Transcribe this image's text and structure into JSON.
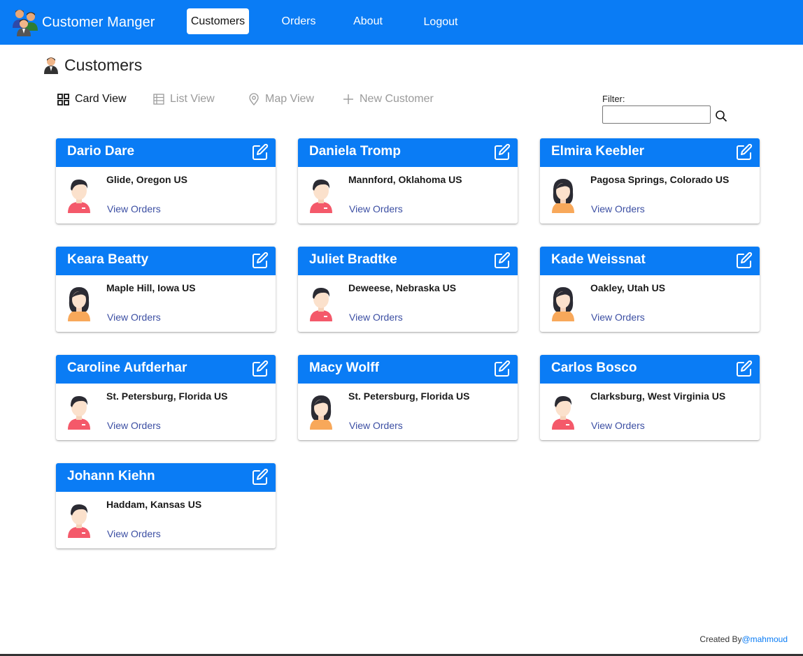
{
  "navbar": {
    "brand": "Customer Manger",
    "links": [
      {
        "label": "Customers",
        "active": true
      },
      {
        "label": "Orders",
        "active": false
      },
      {
        "label": "About",
        "active": false
      },
      {
        "label": "Logout",
        "active": false
      }
    ],
    "color": "#0a7cf5"
  },
  "page": {
    "title": "Customers"
  },
  "toolbar": {
    "card_view": "Card View",
    "list_view": "List View",
    "map_view": "Map View",
    "new_customer": "New Customer",
    "filter_label": "Filter:",
    "filter_value": ""
  },
  "customers": [
    {
      "name": "Dario Dare",
      "location": "Glide, Oregon US",
      "gender": "male",
      "link": "View Orders"
    },
    {
      "name": "Daniela Tromp",
      "location": "Mannford, Oklahoma US",
      "gender": "male",
      "link": "View Orders"
    },
    {
      "name": "Elmira Keebler",
      "location": "Pagosa Springs, Colorado US",
      "gender": "female",
      "link": "View Orders"
    },
    {
      "name": "Keara Beatty",
      "location": "Maple Hill, Iowa US",
      "gender": "female",
      "link": "View Orders"
    },
    {
      "name": "Juliet Bradtke",
      "location": "Deweese, Nebraska US",
      "gender": "male",
      "link": "View Orders"
    },
    {
      "name": "Kade Weissnat",
      "location": "Oakley, Utah US",
      "gender": "female",
      "link": "View Orders"
    },
    {
      "name": "Caroline Aufderhar",
      "location": "St. Petersburg, Florida US",
      "gender": "male",
      "link": "View Orders"
    },
    {
      "name": "Macy Wolff",
      "location": "St. Petersburg, Florida US",
      "gender": "female",
      "link": "View Orders"
    },
    {
      "name": "Carlos Bosco",
      "location": "Clarksburg, West Virginia US",
      "gender": "male",
      "link": "View Orders"
    },
    {
      "name": "Johann Kiehn",
      "location": "Haddam, Kansas US",
      "gender": "male",
      "link": "View Orders"
    }
  ],
  "footer": {
    "text": "Created By",
    "handle": "@mahmoud"
  }
}
